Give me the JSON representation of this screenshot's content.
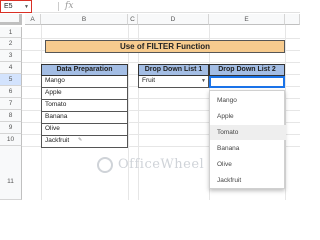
{
  "formula_bar": {
    "name_box": "E5",
    "fx": "fx"
  },
  "columns": [
    "A",
    "B",
    "C",
    "D",
    "E"
  ],
  "rows": [
    "1",
    "2",
    "3",
    "4",
    "5",
    "6",
    "7",
    "8",
    "9",
    "10",
    "11"
  ],
  "title": "Use of FILTER Function",
  "table1": {
    "header": "Data Preparation",
    "items": [
      "Mango",
      "Apple",
      "Tomato",
      "Banana",
      "Olive",
      "Jackfruit"
    ]
  },
  "table2": {
    "header": "Drop Down List 1",
    "value": "Fruit"
  },
  "table3": {
    "header": "Drop Down List 2",
    "value": ""
  },
  "dropdown_options": [
    "Mango",
    "Apple",
    "Tomato",
    "Banana",
    "Olive",
    "Jackfruit"
  ],
  "highlighted_option": "Tomato",
  "watermark": "OfficeWheel"
}
